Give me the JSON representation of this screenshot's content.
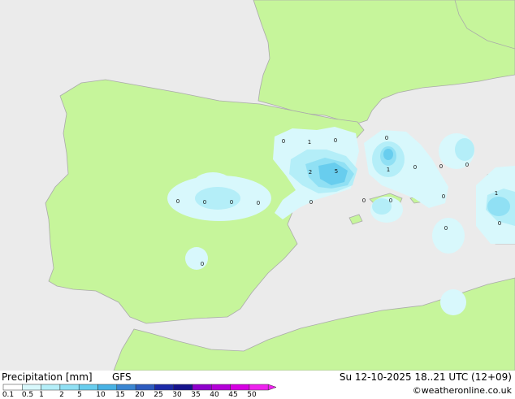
{
  "footer": {
    "title": "Precipitation [mm]",
    "model": "GFS",
    "datetime": "Su 12-10-2025 18..21 UTC (12+09)",
    "credit": "©weatheronline.co.uk"
  },
  "legend": {
    "ticks": [
      "0.1",
      "0.5",
      "1",
      "2",
      "5",
      "10",
      "15",
      "20",
      "25",
      "30",
      "35",
      "40",
      "45",
      "50"
    ],
    "colors": [
      "#ffffff",
      "#d8f8fc",
      "#b4eef8",
      "#90e0f4",
      "#68cdee",
      "#48b2e4",
      "#3b86d2",
      "#2d5bbf",
      "#1c2aa8",
      "#16138c",
      "#8e00cc",
      "#b400d8",
      "#d600e2",
      "#ee22ee"
    ]
  },
  "map_colors": {
    "sea": "#ebebeb",
    "land": "#c6f59b",
    "border": "#aaaaaa"
  },
  "values": [
    "0",
    "1",
    "0",
    "2",
    "5",
    "0",
    "0",
    "0",
    "0",
    "0",
    "0",
    "0",
    "0",
    "0",
    "1",
    "0",
    "0",
    "0",
    "0",
    "0",
    "1",
    "0",
    "0"
  ]
}
